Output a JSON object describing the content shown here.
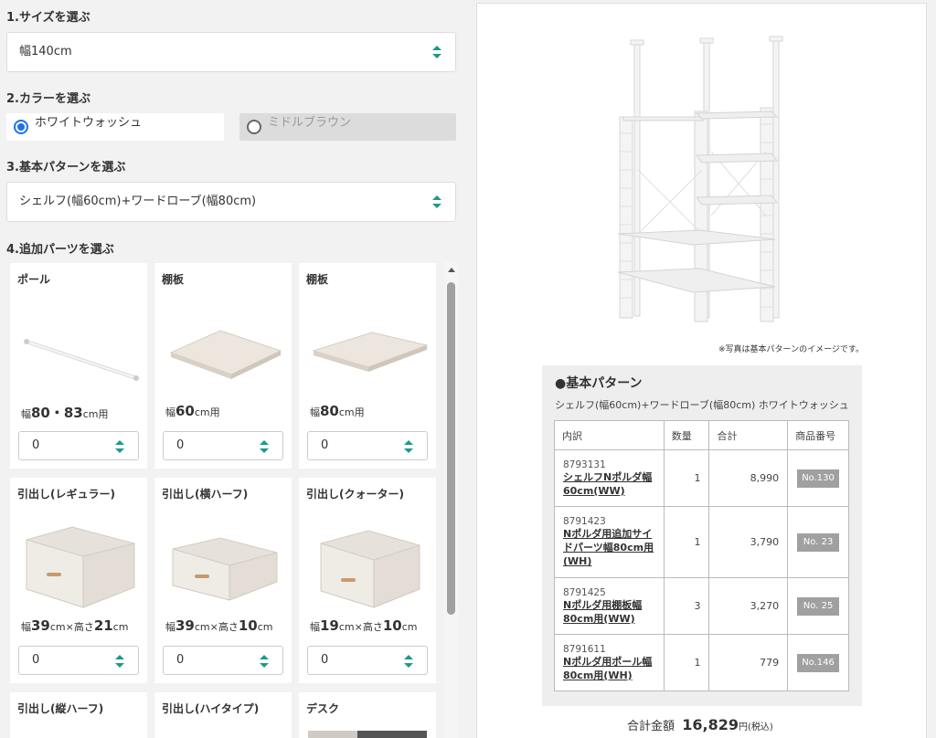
{
  "steps": {
    "size": {
      "title": "1.サイズを選ぶ",
      "value": "幅140cm"
    },
    "color": {
      "title": "2.カラーを選ぶ",
      "options": [
        {
          "label": "ホワイトウォッシュ",
          "checked": true
        },
        {
          "label": "ミドルブラウン",
          "checked": false
        }
      ]
    },
    "pattern": {
      "title": "3.基本パターンを選ぶ",
      "value": "シェルフ(幅60cm)+ワードローブ(幅80cm)"
    },
    "parts": {
      "title": "4.追加パーツを選ぶ"
    }
  },
  "parts": [
    {
      "name": "ポール",
      "size_big1": "80・83",
      "size_unit1": "cm用",
      "qty": "0"
    },
    {
      "name": "棚板",
      "size_big1": "60",
      "size_unit1": "cm用",
      "qty": "0"
    },
    {
      "name": "棚板",
      "size_big1": "80",
      "size_unit1": "cm用",
      "qty": "0"
    },
    {
      "name": "引出し(レギュラー)",
      "size_pre": "幅",
      "size_big1": "39",
      "size_unit1": "cm×高さ",
      "size_big2": "21",
      "size_unit2": "cm",
      "qty": "0"
    },
    {
      "name": "引出し(横ハーフ)",
      "size_pre": "幅",
      "size_big1": "39",
      "size_unit1": "cm×高さ",
      "size_big2": "10",
      "size_unit2": "cm",
      "qty": "0"
    },
    {
      "name": "引出し(クォーター)",
      "size_pre": "幅",
      "size_big1": "19",
      "size_unit1": "cm×高さ",
      "size_big2": "10",
      "size_unit2": "cm",
      "qty": "0"
    },
    {
      "name": "引出し(縦ハーフ)"
    },
    {
      "name": "引出し(ハイタイプ)"
    },
    {
      "name": "デスク"
    }
  ],
  "preview": {
    "note": "※写真は基本パターンのイメージです。"
  },
  "summary": {
    "title": "●基本パターン",
    "subtitle": "シェルフ(幅60cm)+ワードローブ(幅80cm) ホワイトウォッシュ",
    "headers": [
      "内訳",
      "数量",
      "合計",
      "商品番号"
    ],
    "rows": [
      {
        "code": "8793131",
        "name": "シェルフNポルダ幅60cm(WW)",
        "qty": "1",
        "total": "8,990",
        "no": "No.130"
      },
      {
        "code": "8791423",
        "name": "Nポルダ用追加サイドパーツ幅80cm用(WH)",
        "qty": "1",
        "total": "3,790",
        "no": "No. 23"
      },
      {
        "code": "8791425",
        "name": "Nポルダ用棚板幅80cm用(WW)",
        "qty": "3",
        "total": "3,270",
        "no": "No. 25"
      },
      {
        "code": "8791611",
        "name": "Nポルダ用ポール幅80cm用(WH)",
        "qty": "1",
        "total": "779",
        "no": "No.146"
      }
    ],
    "total_label": "合計金額",
    "total_amount": "16,829",
    "total_unit": "円",
    "total_tax": "(税込)"
  },
  "colors": {
    "accent": "#1a73e8",
    "arrow": "#1a9a8a",
    "badge": "#a0a0a0"
  }
}
